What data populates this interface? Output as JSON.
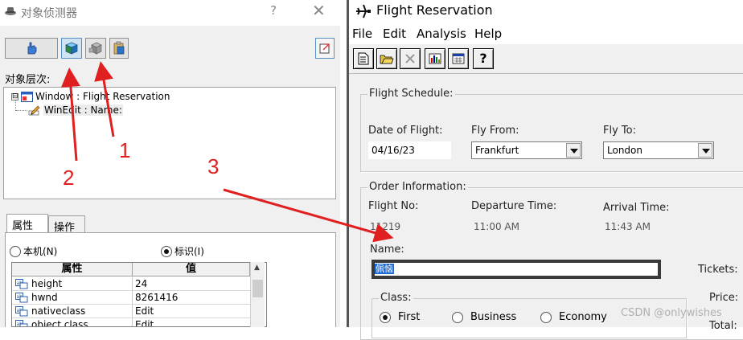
{
  "spy": {
    "title": "对象侦测器",
    "help_glyph": "?",
    "close_glyph": "✕",
    "toolbar": [
      "pointer-hand-icon",
      "object-cube-icon",
      "object-cube-gray-icon",
      "clipboard-icon",
      "window-toggle-icon"
    ],
    "hierarchy_label": "对象层次:",
    "tree": [
      {
        "expander": "⊟",
        "label": "Window : Flight Reservation"
      },
      {
        "label": "WinEdit : Name:"
      }
    ],
    "tabs": [
      "属性",
      "操作"
    ],
    "radios": [
      {
        "label": "本机(N)",
        "checked": false
      },
      {
        "label": "标识(I)",
        "checked": true
      }
    ],
    "grid": {
      "headers": [
        "属性",
        "值"
      ],
      "rows": [
        {
          "name": "height",
          "value": "24"
        },
        {
          "name": "hwnd",
          "value": "8261416"
        },
        {
          "name": "nativeclass",
          "value": "Edit"
        },
        {
          "name": "object class",
          "value": "Edit"
        }
      ]
    }
  },
  "app": {
    "title": "Flight Reservation",
    "menu": [
      "File",
      "Edit",
      "Analysis",
      "Help"
    ],
    "help_button": "?",
    "schedule": {
      "title": "Flight Schedule:",
      "date_label": "Date of Flight:",
      "date_value": "04/16/23",
      "from_label": "Fly From:",
      "from_value": "Frankfurt",
      "to_label": "Fly To:",
      "to_value": "London"
    },
    "order": {
      "title": "Order Information:",
      "flight_no_label": "Flight No:",
      "flight_no_value": "11219",
      "departure_label": "Departure Time:",
      "departure_value": "11:00 AM",
      "arrival_label": "Arrival Time:",
      "arrival_value": "11:43 AM",
      "name_label": "Name:",
      "name_value": "佩恼",
      "tickets_label": "Tickets:",
      "price_label": "Price:",
      "total_label": "Total:",
      "class_title": "Class:",
      "classes": [
        {
          "label": "First",
          "checked": true
        },
        {
          "label": "Business",
          "checked": false
        },
        {
          "label": "Economy",
          "checked": false
        }
      ]
    }
  },
  "annotations": {
    "numbers": [
      "1",
      "2",
      "3"
    ],
    "color": "#e02020"
  },
  "watermark": "CSDN @onlywishes"
}
